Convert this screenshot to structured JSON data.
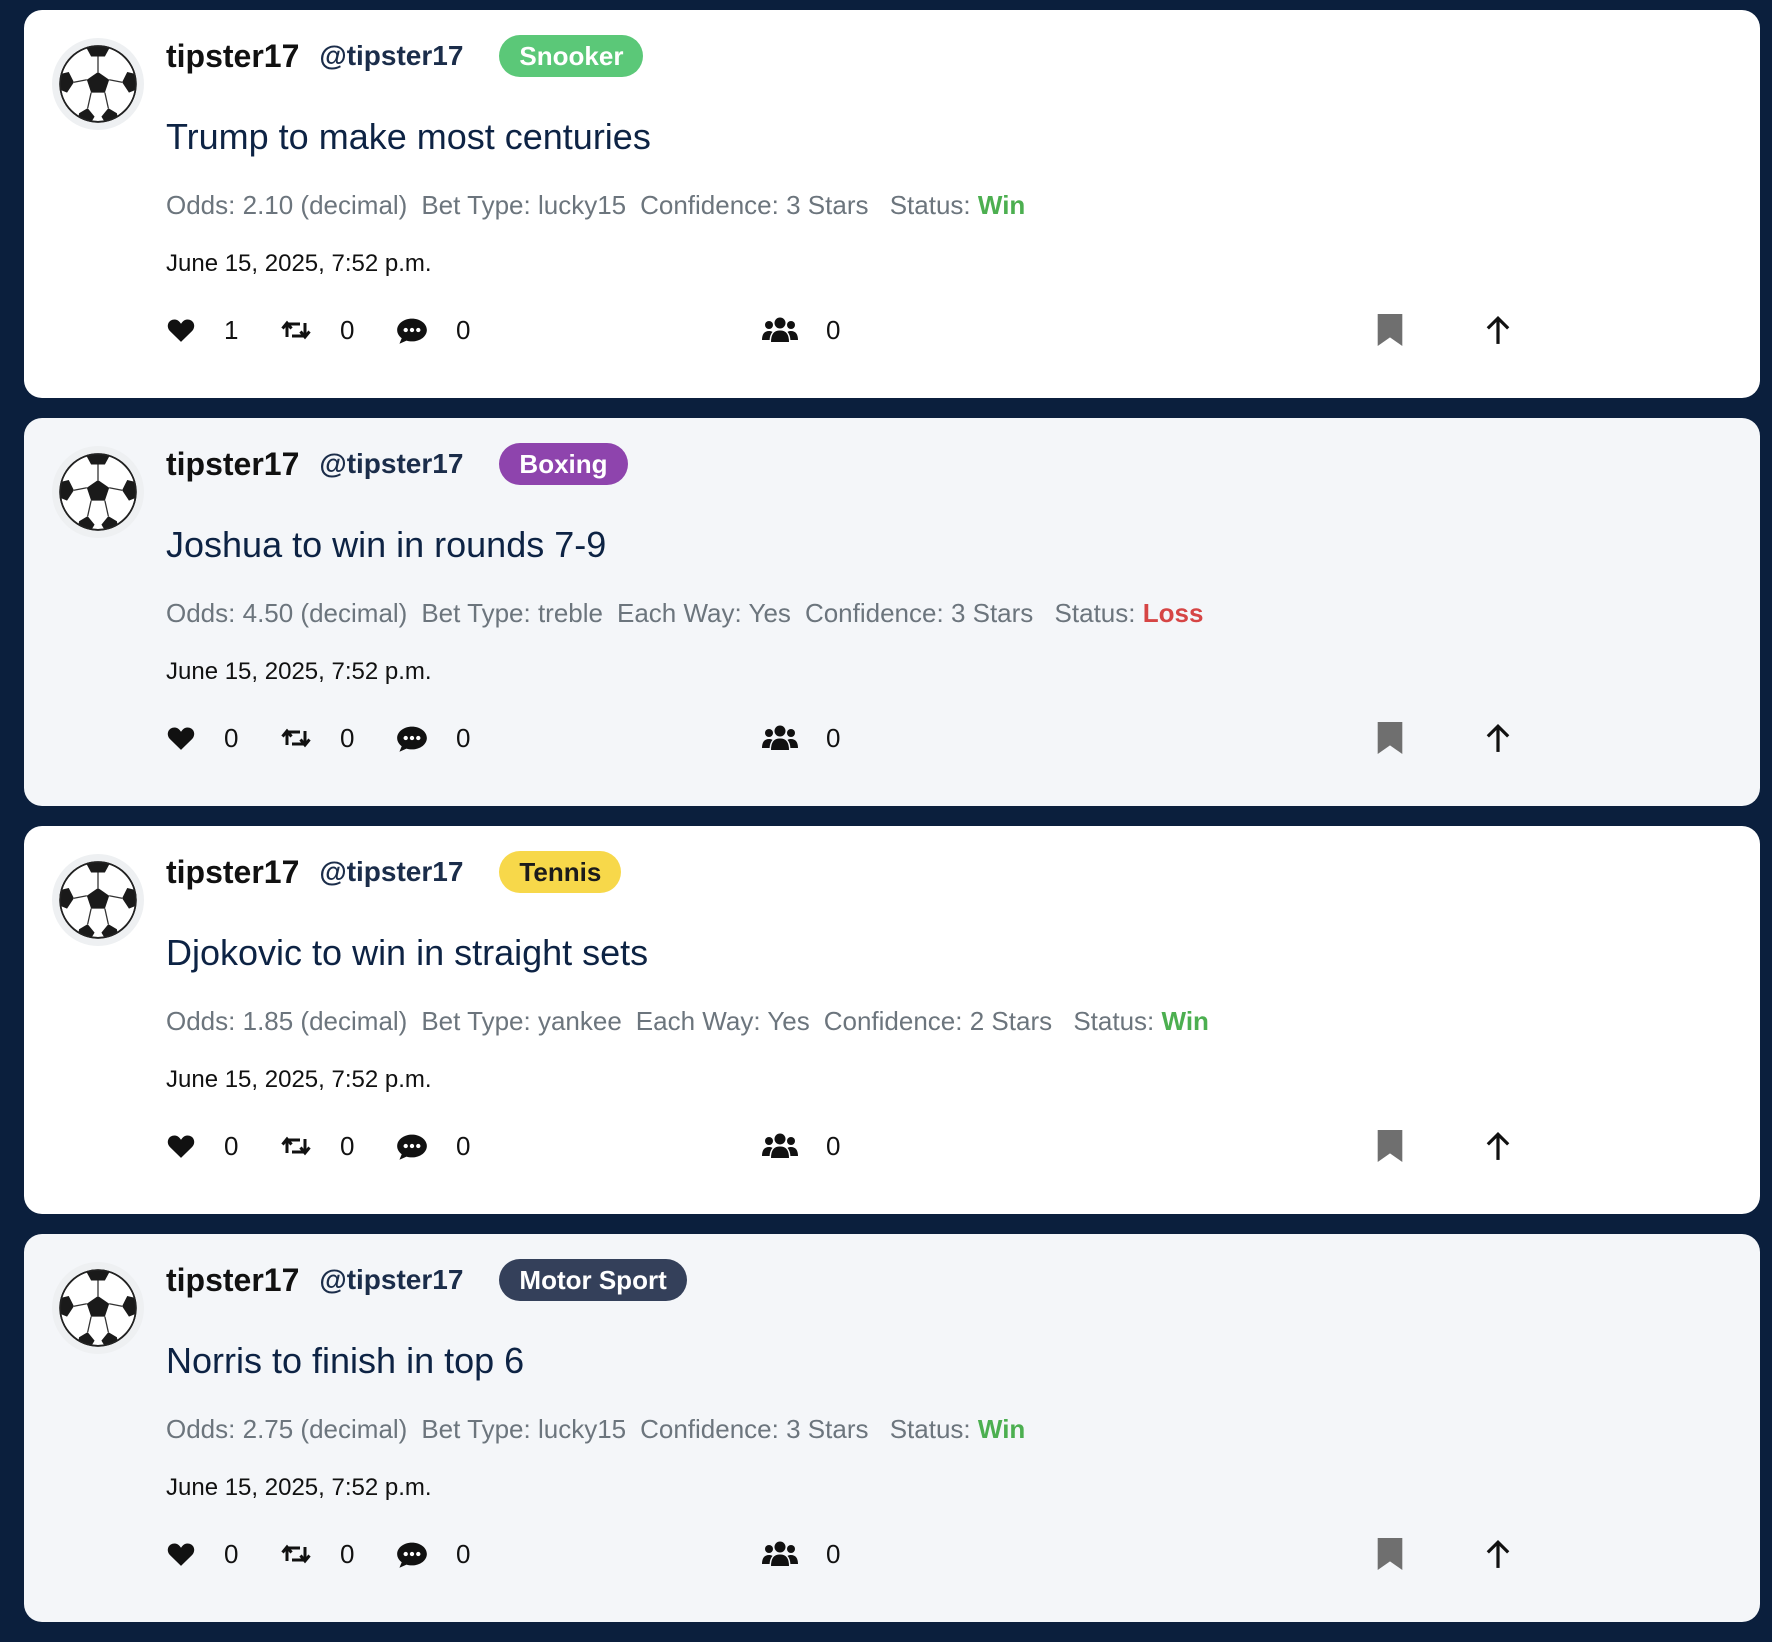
{
  "colors": {
    "page_background": "#0b1f3d",
    "win": "#4caf50",
    "loss": "#d64545"
  },
  "tips": [
    {
      "display_name": "tipster17",
      "handle": "@tipster17",
      "avatar_icon": "soccer-ball-icon",
      "sport": {
        "label": "Snooker",
        "bg": "#5bc878",
        "fg": "#ffffff"
      },
      "title": "Trump to make most centuries",
      "meta": [
        {
          "label": "Odds:",
          "value": "2.10 (decimal)"
        },
        {
          "label": "Bet Type:",
          "value": "lucky15"
        },
        {
          "label": "Confidence:",
          "value": "3 Stars"
        }
      ],
      "status_label": "Status:",
      "status_value": "Win",
      "status_color": "#4caf50",
      "timestamp": "June 15, 2025, 7:52 p.m.",
      "likes": "1",
      "reposts": "0",
      "comments": "0",
      "followers": "0"
    },
    {
      "display_name": "tipster17",
      "handle": "@tipster17",
      "avatar_icon": "soccer-ball-icon",
      "sport": {
        "label": "Boxing",
        "bg": "#8e44ad",
        "fg": "#ffffff"
      },
      "title": "Joshua to win in rounds 7-9",
      "meta": [
        {
          "label": "Odds:",
          "value": "4.50 (decimal)"
        },
        {
          "label": "Bet Type:",
          "value": "treble"
        },
        {
          "label": "Each Way:",
          "value": "Yes"
        },
        {
          "label": "Confidence:",
          "value": "3 Stars"
        }
      ],
      "status_label": "Status:",
      "status_value": "Loss",
      "status_color": "#d64545",
      "timestamp": "June 15, 2025, 7:52 p.m.",
      "likes": "0",
      "reposts": "0",
      "comments": "0",
      "followers": "0"
    },
    {
      "display_name": "tipster17",
      "handle": "@tipster17",
      "avatar_icon": "soccer-ball-icon",
      "sport": {
        "label": "Tennis",
        "bg": "#f7d84a",
        "fg": "#1b1b1b"
      },
      "title": "Djokovic to win in straight sets",
      "meta": [
        {
          "label": "Odds:",
          "value": "1.85 (decimal)"
        },
        {
          "label": "Bet Type:",
          "value": "yankee"
        },
        {
          "label": "Each Way:",
          "value": "Yes"
        },
        {
          "label": "Confidence:",
          "value": "2 Stars"
        }
      ],
      "status_label": "Status:",
      "status_value": "Win",
      "status_color": "#4caf50",
      "timestamp": "June 15, 2025, 7:52 p.m.",
      "likes": "0",
      "reposts": "0",
      "comments": "0",
      "followers": "0"
    },
    {
      "display_name": "tipster17",
      "handle": "@tipster17",
      "avatar_icon": "soccer-ball-icon",
      "sport": {
        "label": "Motor Sport",
        "bg": "#34405a",
        "fg": "#ffffff"
      },
      "title": "Norris to finish in top 6",
      "meta": [
        {
          "label": "Odds:",
          "value": "2.75 (decimal)"
        },
        {
          "label": "Bet Type:",
          "value": "lucky15"
        },
        {
          "label": "Confidence:",
          "value": "3 Stars"
        }
      ],
      "status_label": "Status:",
      "status_value": "Win",
      "status_color": "#4caf50",
      "timestamp": "June 15, 2025, 7:52 p.m.",
      "likes": "0",
      "reposts": "0",
      "comments": "0",
      "followers": "0"
    }
  ]
}
